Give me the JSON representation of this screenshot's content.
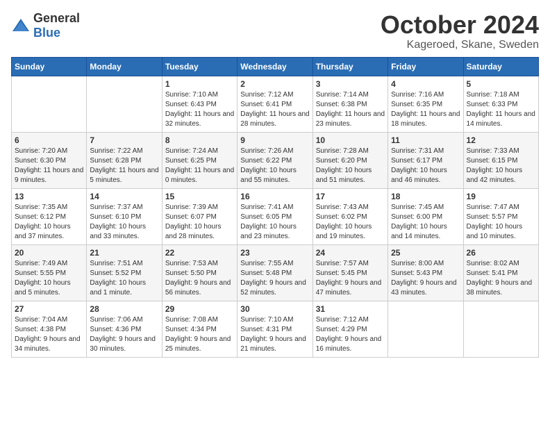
{
  "logo": {
    "text_general": "General",
    "text_blue": "Blue"
  },
  "title": "October 2024",
  "location": "Kageroed, Skane, Sweden",
  "headers": [
    "Sunday",
    "Monday",
    "Tuesday",
    "Wednesday",
    "Thursday",
    "Friday",
    "Saturday"
  ],
  "weeks": [
    [
      {
        "day": "",
        "content": ""
      },
      {
        "day": "",
        "content": ""
      },
      {
        "day": "1",
        "content": "Sunrise: 7:10 AM\nSunset: 6:43 PM\nDaylight: 11 hours\nand 32 minutes."
      },
      {
        "day": "2",
        "content": "Sunrise: 7:12 AM\nSunset: 6:41 PM\nDaylight: 11 hours\nand 28 minutes."
      },
      {
        "day": "3",
        "content": "Sunrise: 7:14 AM\nSunset: 6:38 PM\nDaylight: 11 hours\nand 23 minutes."
      },
      {
        "day": "4",
        "content": "Sunrise: 7:16 AM\nSunset: 6:35 PM\nDaylight: 11 hours\nand 18 minutes."
      },
      {
        "day": "5",
        "content": "Sunrise: 7:18 AM\nSunset: 6:33 PM\nDaylight: 11 hours\nand 14 minutes."
      }
    ],
    [
      {
        "day": "6",
        "content": "Sunrise: 7:20 AM\nSunset: 6:30 PM\nDaylight: 11 hours\nand 9 minutes."
      },
      {
        "day": "7",
        "content": "Sunrise: 7:22 AM\nSunset: 6:28 PM\nDaylight: 11 hours\nand 5 minutes."
      },
      {
        "day": "8",
        "content": "Sunrise: 7:24 AM\nSunset: 6:25 PM\nDaylight: 11 hours\nand 0 minutes."
      },
      {
        "day": "9",
        "content": "Sunrise: 7:26 AM\nSunset: 6:22 PM\nDaylight: 10 hours\nand 55 minutes."
      },
      {
        "day": "10",
        "content": "Sunrise: 7:28 AM\nSunset: 6:20 PM\nDaylight: 10 hours\nand 51 minutes."
      },
      {
        "day": "11",
        "content": "Sunrise: 7:31 AM\nSunset: 6:17 PM\nDaylight: 10 hours\nand 46 minutes."
      },
      {
        "day": "12",
        "content": "Sunrise: 7:33 AM\nSunset: 6:15 PM\nDaylight: 10 hours\nand 42 minutes."
      }
    ],
    [
      {
        "day": "13",
        "content": "Sunrise: 7:35 AM\nSunset: 6:12 PM\nDaylight: 10 hours\nand 37 minutes."
      },
      {
        "day": "14",
        "content": "Sunrise: 7:37 AM\nSunset: 6:10 PM\nDaylight: 10 hours\nand 33 minutes."
      },
      {
        "day": "15",
        "content": "Sunrise: 7:39 AM\nSunset: 6:07 PM\nDaylight: 10 hours\nand 28 minutes."
      },
      {
        "day": "16",
        "content": "Sunrise: 7:41 AM\nSunset: 6:05 PM\nDaylight: 10 hours\nand 23 minutes."
      },
      {
        "day": "17",
        "content": "Sunrise: 7:43 AM\nSunset: 6:02 PM\nDaylight: 10 hours\nand 19 minutes."
      },
      {
        "day": "18",
        "content": "Sunrise: 7:45 AM\nSunset: 6:00 PM\nDaylight: 10 hours\nand 14 minutes."
      },
      {
        "day": "19",
        "content": "Sunrise: 7:47 AM\nSunset: 5:57 PM\nDaylight: 10 hours\nand 10 minutes."
      }
    ],
    [
      {
        "day": "20",
        "content": "Sunrise: 7:49 AM\nSunset: 5:55 PM\nDaylight: 10 hours\nand 5 minutes."
      },
      {
        "day": "21",
        "content": "Sunrise: 7:51 AM\nSunset: 5:52 PM\nDaylight: 10 hours\nand 1 minute."
      },
      {
        "day": "22",
        "content": "Sunrise: 7:53 AM\nSunset: 5:50 PM\nDaylight: 9 hours\nand 56 minutes."
      },
      {
        "day": "23",
        "content": "Sunrise: 7:55 AM\nSunset: 5:48 PM\nDaylight: 9 hours\nand 52 minutes."
      },
      {
        "day": "24",
        "content": "Sunrise: 7:57 AM\nSunset: 5:45 PM\nDaylight: 9 hours\nand 47 minutes."
      },
      {
        "day": "25",
        "content": "Sunrise: 8:00 AM\nSunset: 5:43 PM\nDaylight: 9 hours\nand 43 minutes."
      },
      {
        "day": "26",
        "content": "Sunrise: 8:02 AM\nSunset: 5:41 PM\nDaylight: 9 hours\nand 38 minutes."
      }
    ],
    [
      {
        "day": "27",
        "content": "Sunrise: 7:04 AM\nSunset: 4:38 PM\nDaylight: 9 hours\nand 34 minutes."
      },
      {
        "day": "28",
        "content": "Sunrise: 7:06 AM\nSunset: 4:36 PM\nDaylight: 9 hours\nand 30 minutes."
      },
      {
        "day": "29",
        "content": "Sunrise: 7:08 AM\nSunset: 4:34 PM\nDaylight: 9 hours\nand 25 minutes."
      },
      {
        "day": "30",
        "content": "Sunrise: 7:10 AM\nSunset: 4:31 PM\nDaylight: 9 hours\nand 21 minutes."
      },
      {
        "day": "31",
        "content": "Sunrise: 7:12 AM\nSunset: 4:29 PM\nDaylight: 9 hours\nand 16 minutes."
      },
      {
        "day": "",
        "content": ""
      },
      {
        "day": "",
        "content": ""
      }
    ]
  ]
}
